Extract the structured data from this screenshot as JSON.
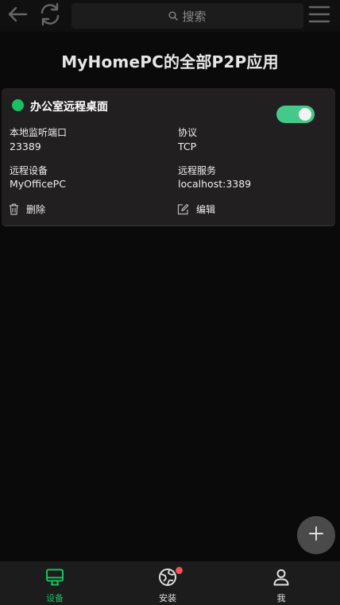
{
  "header": {
    "search_placeholder": "搜索"
  },
  "page": {
    "title": "MyHomePC的全部P2P应用"
  },
  "card": {
    "name": "办公室远程桌面",
    "enabled": true,
    "status_color": "#19c160",
    "fields": {
      "local_port_label": "本地监听端口",
      "local_port_value": "23389",
      "protocol_label": "协议",
      "protocol_value": "TCP",
      "remote_device_label": "远程设备",
      "remote_device_value": "MyOfficePC",
      "remote_service_label": "远程服务",
      "remote_service_value": "localhost:3389"
    },
    "actions": {
      "delete_label": "删除",
      "edit_label": "编辑"
    }
  },
  "nav": {
    "items": [
      {
        "label": "设备",
        "icon": "monitor-icon",
        "active": true
      },
      {
        "label": "安装",
        "icon": "install-icon",
        "active": false,
        "has_badge": true
      },
      {
        "label": "我",
        "icon": "user-icon",
        "active": false
      }
    ]
  },
  "colors": {
    "accent": "#19c160",
    "toggle_on": "#45c98a",
    "badge": "#f25353"
  }
}
